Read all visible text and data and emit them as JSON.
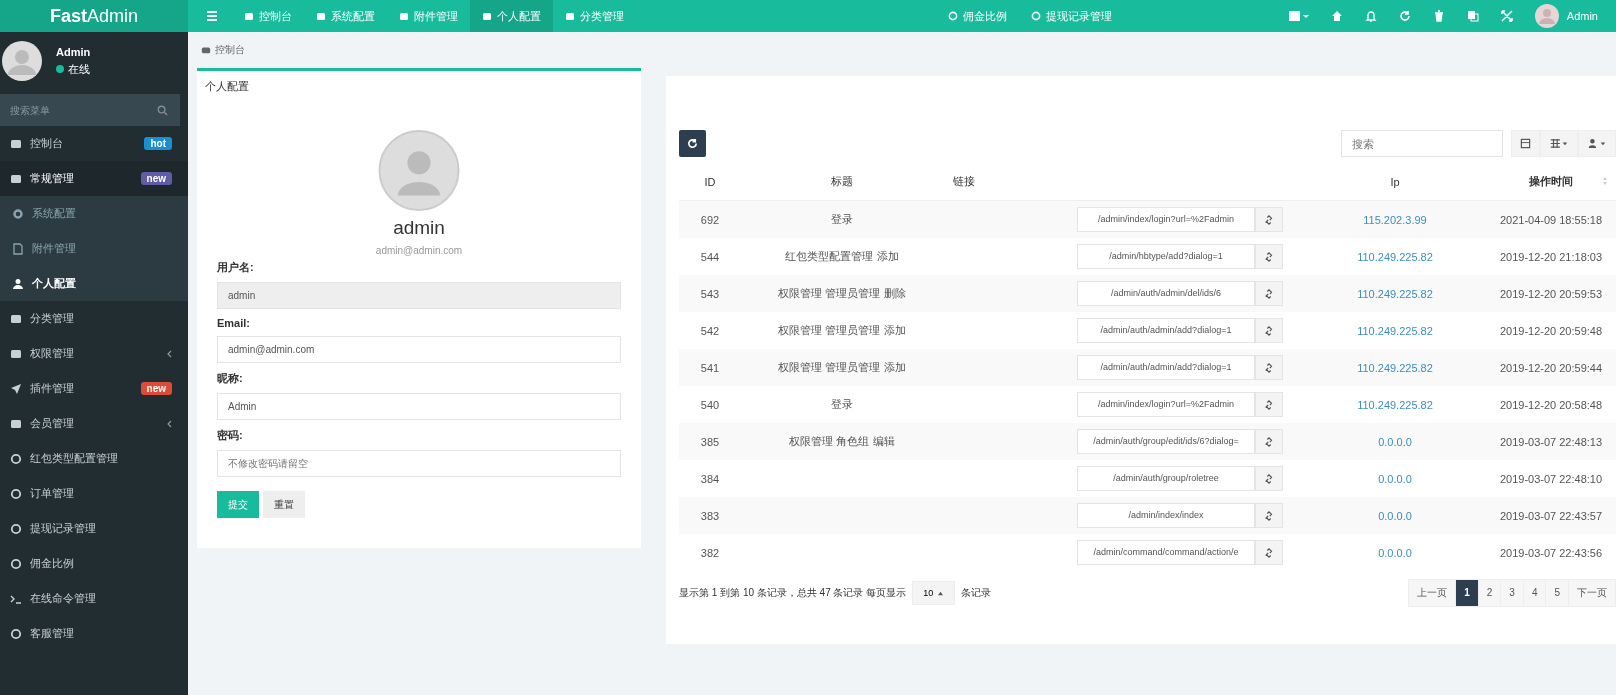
{
  "brand": {
    "bold": "Fast",
    "rest": "Admin"
  },
  "topnav": [
    {
      "label": "控制台",
      "selected": false
    },
    {
      "label": "系统配置",
      "selected": false
    },
    {
      "label": "附件管理",
      "selected": false
    },
    {
      "label": "个人配置",
      "selected": true
    },
    {
      "label": "分类管理",
      "selected": false
    },
    {
      "label": "佣金比例",
      "selected": false
    },
    {
      "label": "提现记录管理",
      "selected": false
    }
  ],
  "top_user": "Admin",
  "user": {
    "name": "Admin",
    "status": "在线"
  },
  "sidebar_search": {
    "placeholder": "搜索菜单"
  },
  "sidebar": [
    {
      "label": "控制台",
      "badge": "hot",
      "color": "#1a8fd6",
      "selected": false
    },
    {
      "label": "常规管理",
      "badge": "new",
      "color": "#605ca8",
      "selected": false,
      "expanded": true,
      "children": [
        {
          "label": "系统配置",
          "selected": false
        },
        {
          "label": "附件管理",
          "selected": false
        },
        {
          "label": "个人配置",
          "selected": true
        }
      ]
    },
    {
      "label": "分类管理",
      "selected": false
    },
    {
      "label": "权限管理",
      "selected": false,
      "expanded": false
    },
    {
      "label": "插件管理",
      "badge": "new",
      "color": "#dd4b39",
      "selected": false
    },
    {
      "label": "会员管理",
      "selected": false,
      "expanded": false
    },
    {
      "label": "红包类型配置管理",
      "selected": false
    },
    {
      "label": "订单管理",
      "selected": false
    },
    {
      "label": "提现记录管理",
      "selected": false
    },
    {
      "label": "佣金比例",
      "selected": false
    },
    {
      "label": "在线命令管理",
      "selected": false
    },
    {
      "label": "客服管理",
      "selected": false
    }
  ],
  "breadcrumb": "控制台",
  "profile": {
    "title": "个人配置",
    "name": "admin",
    "email": "admin@admin.com",
    "fields": [
      {
        "label": "用户名:",
        "value": "admin",
        "disabled": true
      },
      {
        "label": "Email:",
        "value": "admin@admin.com",
        "disabled": false
      },
      {
        "label": "昵称:",
        "value": "Admin",
        "disabled": false
      },
      {
        "label": "密码:",
        "placeholder": "不修改密码请留空",
        "disabled": false
      }
    ],
    "buttons": [
      "提交",
      "重置"
    ]
  },
  "table": {
    "search_placeholder": "搜索",
    "columns": [
      "ID",
      "标题",
      "链接",
      "Ip",
      "操作时间"
    ],
    "rows": [
      {
        "id": "692",
        "title": "登录",
        "url": "/admin/index/login?url=%2Fadmin",
        "ip": "115.202.3.99",
        "time": "2021-04-09 18:55:18"
      },
      {
        "id": "544",
        "title": "红包类型配置管理 添加",
        "url": "/admin/hbtype/add?dialog=1",
        "ip": "110.249.225.82",
        "time": "2019-12-20 21:18:03"
      },
      {
        "id": "543",
        "title": "权限管理 管理员管理 删除",
        "url": "/admin/auth/admin/del/ids/6",
        "ip": "110.249.225.82",
        "time": "2019-12-20 20:59:53"
      },
      {
        "id": "542",
        "title": "权限管理 管理员管理 添加",
        "url": "/admin/auth/admin/add?dialog=1",
        "ip": "110.249.225.82",
        "time": "2019-12-20 20:59:48"
      },
      {
        "id": "541",
        "title": "权限管理 管理员管理 添加",
        "url": "/admin/auth/admin/add?dialog=1",
        "ip": "110.249.225.82",
        "time": "2019-12-20 20:59:44"
      },
      {
        "id": "540",
        "title": "登录",
        "url": "/admin/index/login?url=%2Fadmin",
        "ip": "110.249.225.82",
        "time": "2019-12-20 20:58:48"
      },
      {
        "id": "385",
        "title": "权限管理 角色组 编辑",
        "url": "/admin/auth/group/edit/ids/6?dialog=",
        "ip": "0.0.0.0",
        "time": "2019-03-07 22:48:13"
      },
      {
        "id": "384",
        "url": "/admin/auth/group/roletree",
        "ip": "0.0.0.0",
        "time": "2019-03-07 22:48:10"
      },
      {
        "id": "383",
        "url": "/admin/index/index",
        "ip": "0.0.0.0",
        "time": "2019-03-07 22:43:57"
      },
      {
        "id": "382",
        "url": "/admin/command/command/action/e",
        "ip": "0.0.0.0",
        "time": "2019-03-07 22:43:56"
      }
    ],
    "summary": "显示第 1 到第 10 条记录，总共 47 条记录 每页显示",
    "page_size": "10",
    "page_size_suffix": "条记录",
    "pages": [
      {
        "label": "上一页",
        "selected": false
      },
      {
        "label": "1",
        "selected": true
      },
      {
        "label": "2",
        "selected": false
      },
      {
        "label": "3",
        "selected": false
      },
      {
        "label": "4",
        "selected": false
      },
      {
        "label": "5",
        "selected": false
      },
      {
        "label": "下一页",
        "selected": false
      }
    ]
  }
}
